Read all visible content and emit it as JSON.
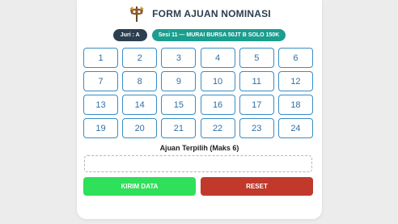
{
  "form": {
    "title": "FORM AJUAN NOMINASI",
    "juri_badge": "Juri : A",
    "sesi_badge": "Sesi 11 — MURAI BURSA 50JT B SOLO 150K",
    "numbers": [
      "1",
      "2",
      "3",
      "4",
      "5",
      "6",
      "7",
      "8",
      "9",
      "10",
      "11",
      "12",
      "13",
      "14",
      "15",
      "16",
      "17",
      "18",
      "19",
      "20",
      "21",
      "22",
      "23",
      "24"
    ],
    "selected_label": "Ajuan Terpilih (Maks 6)",
    "selected_value": "",
    "submit_label": "KIRIM DATA",
    "reset_label": "RESET"
  },
  "colors": {
    "accent_blue": "#3a8dc4",
    "badge_dark": "#2c3e50",
    "badge_teal": "#1a9e8f",
    "submit_green": "#2ee05a",
    "reset_red": "#c0392b"
  },
  "icons": {
    "logo": "mask-logo-icon"
  }
}
